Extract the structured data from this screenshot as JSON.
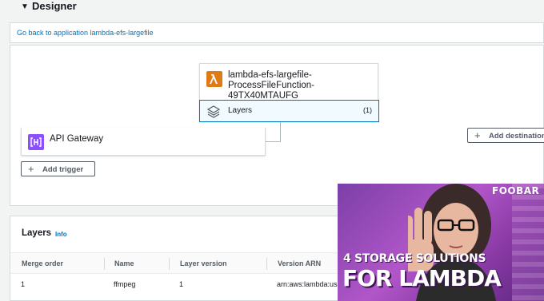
{
  "designer": {
    "title": "Designer",
    "back_link": "Go back to application lambda-efs-largefile"
  },
  "function": {
    "name": "lambda-efs-largefile-ProcessFileFunction-49TX40MTAUFG",
    "layers_label": "Layers",
    "layers_count": "(1)"
  },
  "trigger": {
    "label": "API Gateway",
    "add_trigger": "Add trigger",
    "add_destination": "Add destination"
  },
  "layers_panel": {
    "title": "Layers",
    "info": "Info",
    "columns": [
      "Merge order",
      "Name",
      "Layer version",
      "Version ARN"
    ],
    "rows": [
      [
        "1",
        "ffmpeg",
        "1",
        "arn:aws:lambda:us"
      ]
    ]
  },
  "thumbnail": {
    "brand": "FOOBAR",
    "line1": "4 STORAGE SOLUTIONS",
    "line2": "FOR LAMBDA"
  },
  "colors": {
    "link": "#0073bb",
    "lambda_orange": "#e07a16",
    "api_purple": "#8c4fff",
    "thumb_purple": "#b156c9"
  }
}
